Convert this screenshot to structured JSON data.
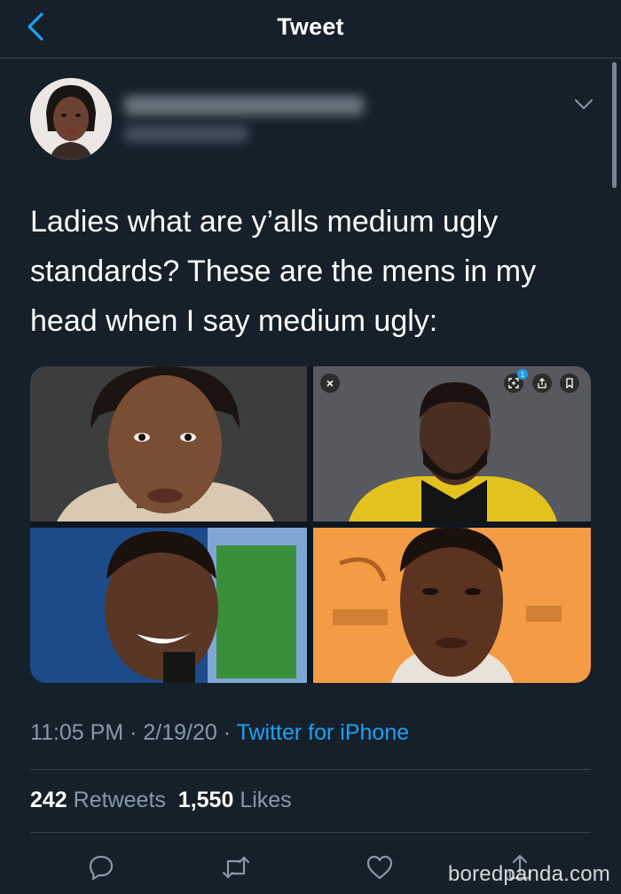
{
  "header": {
    "title": "Tweet"
  },
  "tweet": {
    "text": "Ladies what are y’alls medium ugly standards? These are the mens in my head when I say medium ugly:",
    "time": "11:05 PM",
    "separator": "·",
    "date": "2/19/20",
    "source": "Twitter for iPhone",
    "retweets_count": "242",
    "retweets_label": "Retweets",
    "likes_count": "1,550",
    "likes_label": "Likes"
  },
  "media": {
    "overlay_close": "×",
    "overlay_badge": "1"
  },
  "colors": {
    "background": "#15202b",
    "divider": "#38444d",
    "secondary_text": "#8899a6",
    "link": "#1da1f2"
  },
  "icons": {
    "back": "chevron-left-icon",
    "more": "chevron-down-icon",
    "reply": "reply-icon",
    "retweet": "retweet-icon",
    "like": "heart-icon",
    "share": "share-icon"
  },
  "watermark": "boredpanda.com"
}
